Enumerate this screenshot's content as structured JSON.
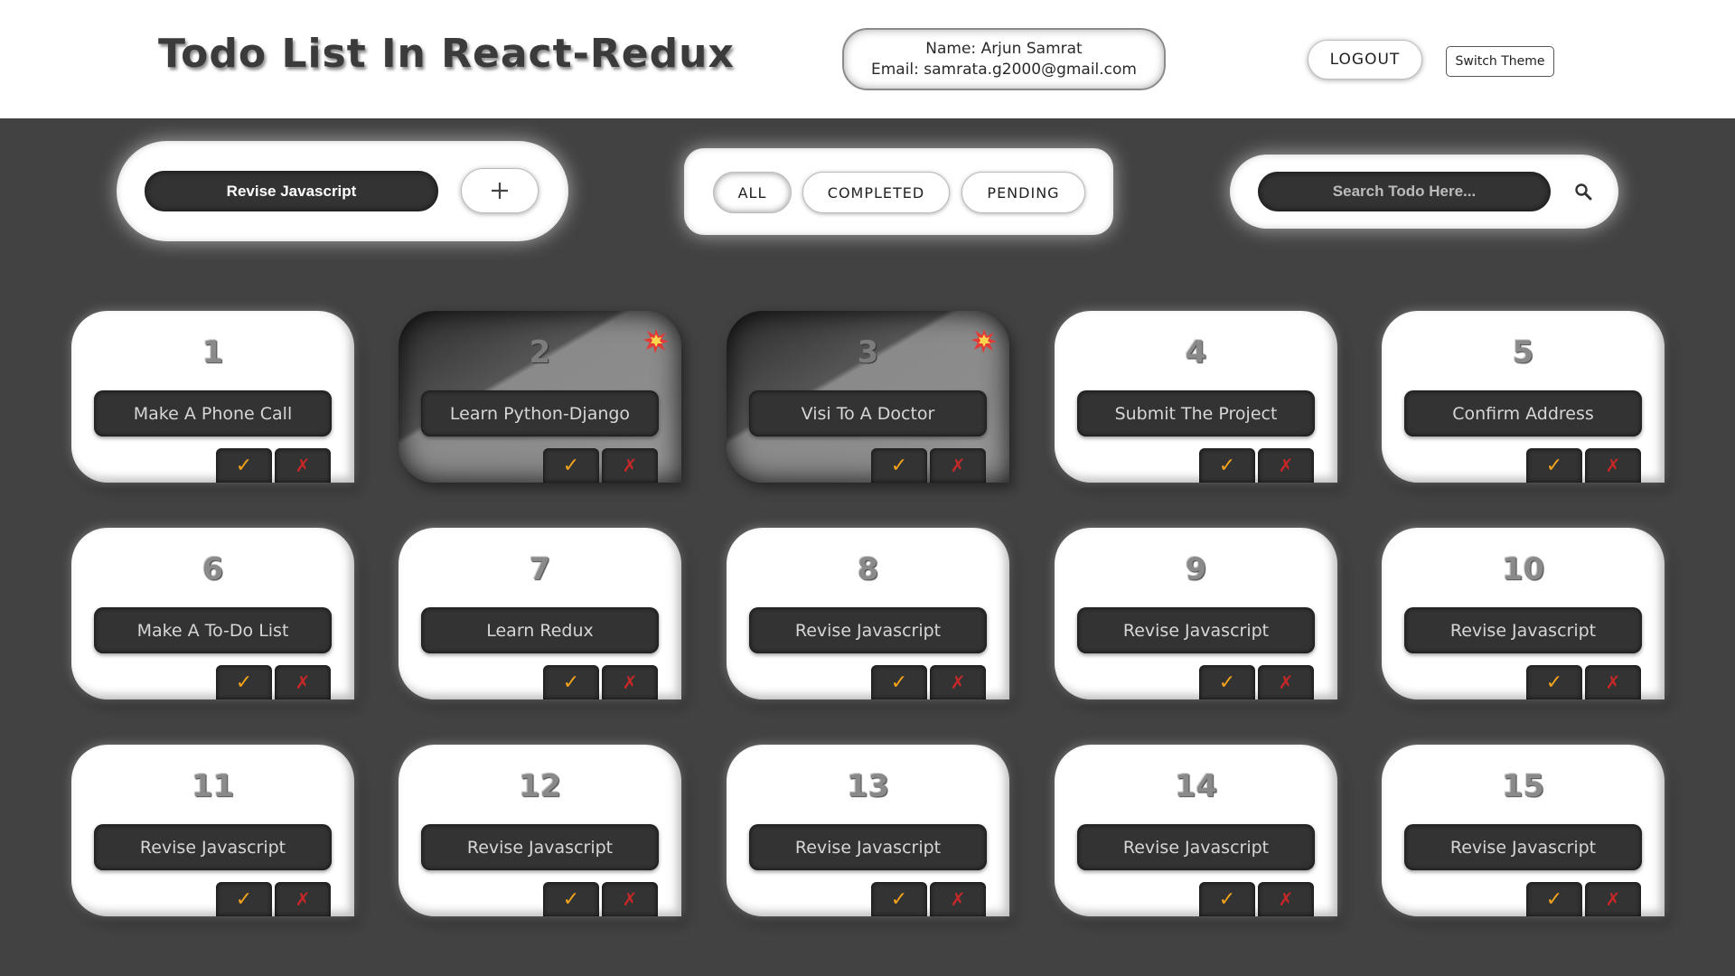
{
  "header": {
    "title": "Todo List In React-Redux",
    "user_name": "Name: Arjun Samrat",
    "user_email": "Email: samrata.g2000@gmail.com",
    "logout_label": "LOGOUT",
    "theme_label": "Switch Theme"
  },
  "add_todo": {
    "value": "Revise Javascript",
    "add_icon": "plus-icon"
  },
  "filters": {
    "all": "ALL",
    "completed": "COMPLETED",
    "pending": "PENDING",
    "active": "all"
  },
  "search": {
    "placeholder": "Search Todo Here...",
    "icon": "search-icon"
  },
  "todos": [
    {
      "number": "1",
      "text": "Make A Phone Call",
      "pending": false
    },
    {
      "number": "2",
      "text": "Learn Python-Django",
      "pending": true
    },
    {
      "number": "3",
      "text": "Visi To A Doctor",
      "pending": true
    },
    {
      "number": "4",
      "text": "Submit The Project",
      "pending": false
    },
    {
      "number": "5",
      "text": "Confirm Address",
      "pending": false
    },
    {
      "number": "6",
      "text": "Make A To-Do List",
      "pending": false
    },
    {
      "number": "7",
      "text": "Learn Redux",
      "pending": false
    },
    {
      "number": "8",
      "text": "Revise Javascript",
      "pending": false
    },
    {
      "number": "9",
      "text": "Revise Javascript",
      "pending": false
    },
    {
      "number": "10",
      "text": "Revise Javascript",
      "pending": false
    },
    {
      "number": "11",
      "text": "Revise Javascript",
      "pending": false
    },
    {
      "number": "12",
      "text": "Revise Javascript",
      "pending": false
    },
    {
      "number": "13",
      "text": "Revise Javascript",
      "pending": false
    },
    {
      "number": "14",
      "text": "Revise Javascript",
      "pending": false
    },
    {
      "number": "15",
      "text": "Revise Javascript",
      "pending": false
    }
  ],
  "card_buttons": {
    "complete_glyph": "✓",
    "delete_glyph": "✗"
  },
  "colors": {
    "background": "#424242",
    "card": "#ffffff",
    "dark_field": "#333333",
    "check_accent": "#f2a21c",
    "delete_accent": "#c62828",
    "pending_marker": "#e53935"
  }
}
